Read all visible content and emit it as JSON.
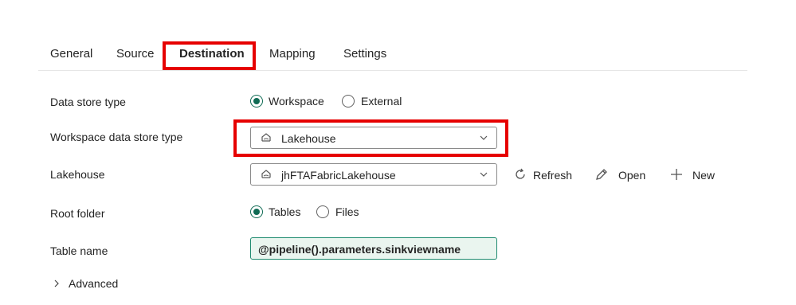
{
  "tabs": [
    {
      "label": "General"
    },
    {
      "label": "Source"
    },
    {
      "label": "Destination"
    },
    {
      "label": "Mapping"
    },
    {
      "label": "Settings"
    }
  ],
  "active_tab": "Destination",
  "data_store_type": {
    "label": "Data store type",
    "options": [
      {
        "label": "Workspace",
        "selected": true
      },
      {
        "label": "External",
        "selected": false
      }
    ]
  },
  "workspace_store_type": {
    "label": "Workspace data store type",
    "value": "Lakehouse"
  },
  "lakehouse": {
    "label": "Lakehouse",
    "value": "jhFTAFabricLakehouse",
    "refresh_label": "Refresh",
    "open_label": "Open",
    "new_label": "New"
  },
  "root_folder": {
    "label": "Root folder",
    "options": [
      {
        "label": "Tables",
        "selected": true
      },
      {
        "label": "Files",
        "selected": false
      }
    ]
  },
  "table_name": {
    "label": "Table name",
    "value": "@pipeline().parameters.sinkviewname"
  },
  "advanced": {
    "label": "Advanced"
  },
  "colors": {
    "accent": "#0f6b54",
    "highlight": "#e60000",
    "input_bg": "#eaf5ef"
  }
}
